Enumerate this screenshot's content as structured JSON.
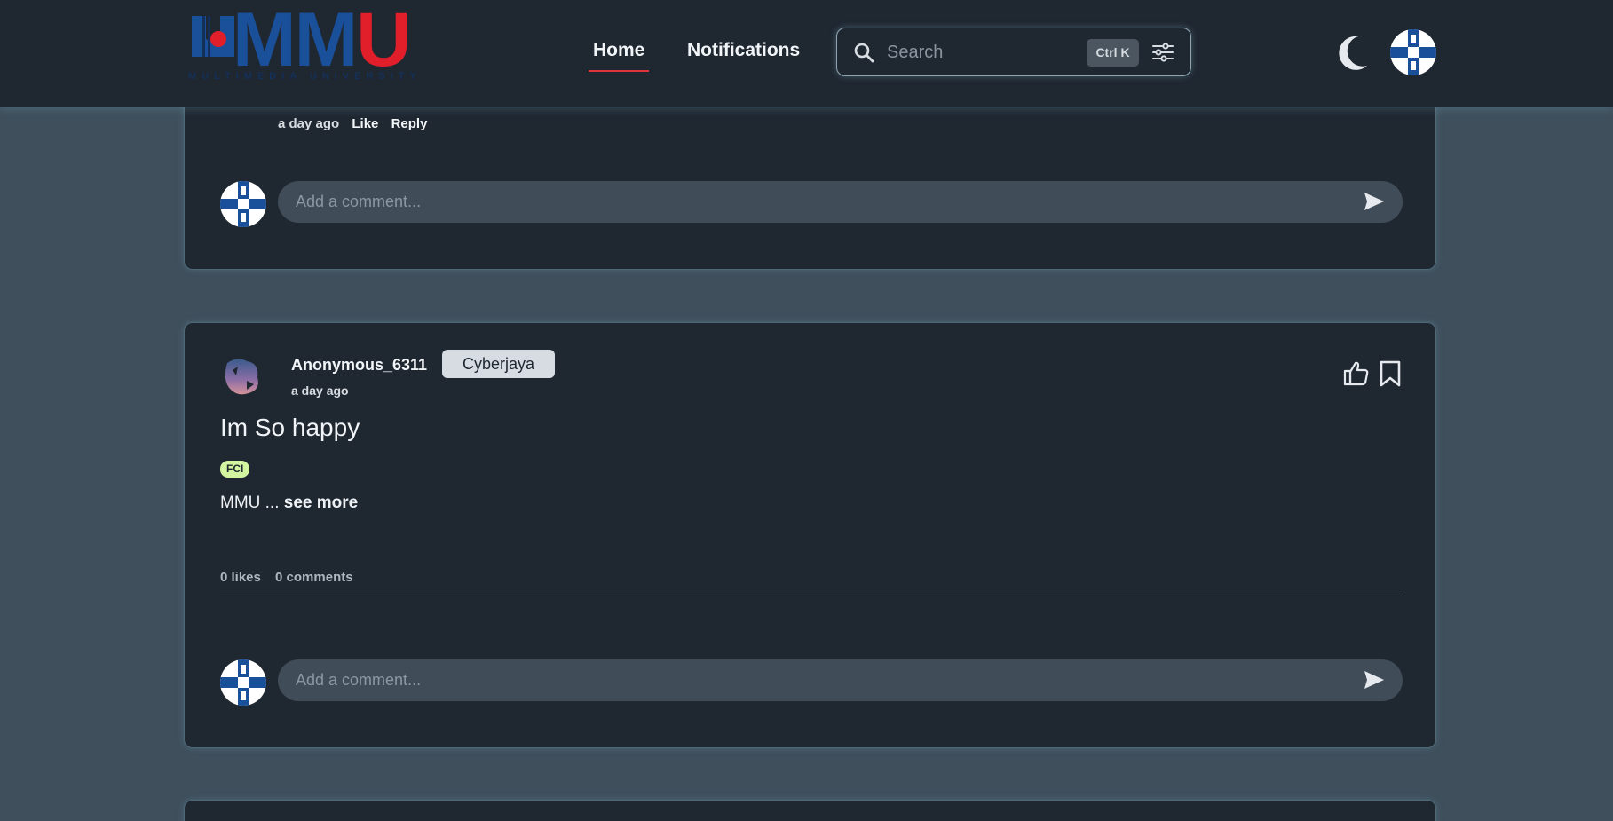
{
  "brand": {
    "logo_text_a": "MM",
    "logo_text_u": "U",
    "logo_sub": "MULTIMEDIA UNIVERSITY",
    "accent_red": "#e11f2a",
    "accent_blue": "#1a4f9a"
  },
  "nav": {
    "home": "Home",
    "notifications": "Notifications"
  },
  "search": {
    "placeholder": "Search",
    "shortcut": "Ctrl K"
  },
  "prev_card": {
    "time": "a day ago",
    "like": "Like",
    "reply": "Reply",
    "comment_placeholder": "Add a comment..."
  },
  "post": {
    "author": "Anonymous_6311",
    "campus": "Cyberjaya",
    "time": "a day ago",
    "title": "Im So happy",
    "tag": "FCI",
    "excerpt": "MMU ...",
    "see_more": "see more",
    "likes": "0 likes",
    "comments": "0 comments",
    "comment_placeholder": "Add a comment..."
  }
}
